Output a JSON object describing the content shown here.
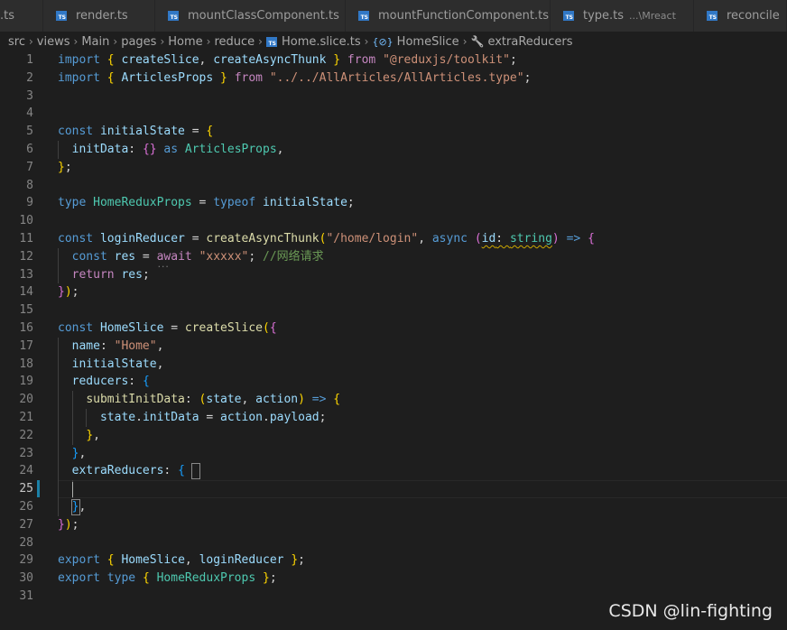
{
  "tabs": [
    {
      "label": ".ts",
      "desc": ""
    },
    {
      "label": "render.ts",
      "desc": ""
    },
    {
      "label": "mountClassComponent.ts",
      "desc": ""
    },
    {
      "label": "mountFunctionComponent.ts",
      "desc": ""
    },
    {
      "label": "type.ts",
      "desc": "...\\Mreact"
    },
    {
      "label": "reconcile",
      "desc": ""
    }
  ],
  "breadcrumb": [
    "src",
    "views",
    "Main",
    "pages",
    "Home",
    "reduce",
    "Home.slice.ts",
    "HomeSlice",
    "extraReducers"
  ],
  "editor": {
    "current_line": 25,
    "lines": [
      [
        [
          "k",
          "import"
        ],
        [
          "p",
          " "
        ],
        [
          "b1",
          "{"
        ],
        [
          "p",
          " "
        ],
        [
          "v",
          "createSlice"
        ],
        [
          "p",
          ", "
        ],
        [
          "v",
          "createAsyncThunk"
        ],
        [
          "p",
          " "
        ],
        [
          "b1",
          "}"
        ],
        [
          "p",
          " "
        ],
        [
          "c",
          "from"
        ],
        [
          "p",
          " "
        ],
        [
          "s",
          "\"@reduxjs/toolkit\""
        ],
        [
          "p",
          ";"
        ]
      ],
      [
        [
          "k",
          "import"
        ],
        [
          "p",
          " "
        ],
        [
          "b1",
          "{"
        ],
        [
          "p",
          " "
        ],
        [
          "v",
          "ArticlesProps"
        ],
        [
          "p",
          " "
        ],
        [
          "b1",
          "}"
        ],
        [
          "p",
          " "
        ],
        [
          "c",
          "from"
        ],
        [
          "p",
          " "
        ],
        [
          "s",
          "\"../../AllArticles/AllArticles.type\""
        ],
        [
          "p",
          ";"
        ]
      ],
      [],
      [],
      [
        [
          "k",
          "const"
        ],
        [
          "p",
          " "
        ],
        [
          "v",
          "initialState"
        ],
        [
          "p",
          " = "
        ],
        [
          "b1",
          "{"
        ]
      ],
      [
        [
          "p",
          "  "
        ],
        [
          "v",
          "initData"
        ],
        [
          "p",
          ": "
        ],
        [
          "b2",
          "{}"
        ],
        [
          "p",
          " "
        ],
        [
          "k",
          "as"
        ],
        [
          "p",
          " "
        ],
        [
          "t",
          "ArticlesProps"
        ],
        [
          "p",
          ","
        ]
      ],
      [
        [
          "b1",
          "}"
        ],
        [
          "p",
          ";"
        ]
      ],
      [],
      [
        [
          "k",
          "type"
        ],
        [
          "p",
          " "
        ],
        [
          "t",
          "HomeReduxProps"
        ],
        [
          "p",
          " = "
        ],
        [
          "k",
          "typeof"
        ],
        [
          "p",
          " "
        ],
        [
          "v",
          "initialState"
        ],
        [
          "p",
          ";"
        ]
      ],
      [],
      [
        [
          "k",
          "const"
        ],
        [
          "p",
          " "
        ],
        [
          "v",
          "loginReducer"
        ],
        [
          "p",
          " = "
        ],
        [
          "f",
          "createAsyncThunk"
        ],
        [
          "b1",
          "("
        ],
        [
          "s",
          "\"/home/login\""
        ],
        [
          "p",
          ", "
        ],
        [
          "k",
          "async"
        ],
        [
          "p",
          " "
        ],
        [
          "b2",
          "("
        ],
        [
          "v sq",
          "id"
        ],
        [
          "p sq",
          ": "
        ],
        [
          "t sq",
          "string"
        ],
        [
          "b2",
          ")"
        ],
        [
          "p",
          " "
        ],
        [
          "k",
          "=>"
        ],
        [
          "p",
          " "
        ],
        [
          "b2",
          "{"
        ]
      ],
      [
        [
          "p",
          "  "
        ],
        [
          "k",
          "const"
        ],
        [
          "p",
          " "
        ],
        [
          "v",
          "res"
        ],
        [
          "p",
          " = "
        ],
        [
          "c dots",
          "await"
        ],
        [
          "p",
          " "
        ],
        [
          "s",
          "\"xxxxx\""
        ],
        [
          "p",
          "; "
        ],
        [
          "cm",
          "//网络请求"
        ]
      ],
      [
        [
          "p",
          "  "
        ],
        [
          "c",
          "return"
        ],
        [
          "p",
          " "
        ],
        [
          "v",
          "res"
        ],
        [
          "p",
          ";"
        ]
      ],
      [
        [
          "b2",
          "}"
        ],
        [
          "b1",
          ")"
        ],
        [
          "p",
          ";"
        ]
      ],
      [],
      [
        [
          "k",
          "const"
        ],
        [
          "p",
          " "
        ],
        [
          "v",
          "HomeSlice"
        ],
        [
          "p",
          " = "
        ],
        [
          "f",
          "createSlice"
        ],
        [
          "b1",
          "("
        ],
        [
          "b2",
          "{"
        ]
      ],
      [
        [
          "p",
          "  "
        ],
        [
          "v",
          "name"
        ],
        [
          "p",
          ": "
        ],
        [
          "s",
          "\"Home\""
        ],
        [
          "p",
          ","
        ]
      ],
      [
        [
          "p",
          "  "
        ],
        [
          "v",
          "initialState"
        ],
        [
          "p",
          ","
        ]
      ],
      [
        [
          "p",
          "  "
        ],
        [
          "v",
          "reducers"
        ],
        [
          "p",
          ": "
        ],
        [
          "b3",
          "{"
        ]
      ],
      [
        [
          "p",
          "    "
        ],
        [
          "f",
          "submitInitData"
        ],
        [
          "p",
          ": "
        ],
        [
          "b1",
          "("
        ],
        [
          "v",
          "state"
        ],
        [
          "p",
          ", "
        ],
        [
          "v",
          "action"
        ],
        [
          "b1",
          ")"
        ],
        [
          "p",
          " "
        ],
        [
          "k",
          "=>"
        ],
        [
          "p",
          " "
        ],
        [
          "b1",
          "{"
        ]
      ],
      [
        [
          "p",
          "      "
        ],
        [
          "v",
          "state"
        ],
        [
          "p",
          "."
        ],
        [
          "v",
          "initData"
        ],
        [
          "p",
          " = "
        ],
        [
          "v",
          "action"
        ],
        [
          "p",
          "."
        ],
        [
          "v",
          "payload"
        ],
        [
          "p",
          ";"
        ]
      ],
      [
        [
          "p",
          "    "
        ],
        [
          "b1",
          "}"
        ],
        [
          "p",
          ","
        ]
      ],
      [
        [
          "p",
          "  "
        ],
        [
          "b3",
          "}"
        ],
        [
          "p",
          ","
        ]
      ],
      [
        [
          "p",
          "  "
        ],
        [
          "v",
          "extraReducers"
        ],
        [
          "p",
          ": "
        ],
        [
          "b3",
          "{"
        ]
      ],
      [],
      [
        [
          "p",
          "  "
        ],
        [
          "b3",
          "}"
        ],
        [
          "p",
          ","
        ]
      ],
      [
        [
          "b2",
          "}"
        ],
        [
          "b1",
          ")"
        ],
        [
          "p",
          ";"
        ]
      ],
      [],
      [
        [
          "k",
          "export"
        ],
        [
          "p",
          " "
        ],
        [
          "b1",
          "{"
        ],
        [
          "p",
          " "
        ],
        [
          "v",
          "HomeSlice"
        ],
        [
          "p",
          ", "
        ],
        [
          "v",
          "loginReducer"
        ],
        [
          "p",
          " "
        ],
        [
          "b1",
          "}"
        ],
        [
          "p",
          ";"
        ]
      ],
      [
        [
          "k",
          "export"
        ],
        [
          "p",
          " "
        ],
        [
          "k",
          "type"
        ],
        [
          "p",
          " "
        ],
        [
          "b1",
          "{"
        ],
        [
          "p",
          " "
        ],
        [
          "t",
          "HomeReduxProps"
        ],
        [
          "p",
          " "
        ],
        [
          "b1",
          "}"
        ],
        [
          "p",
          ";"
        ]
      ],
      []
    ]
  },
  "watermark": "CSDN @lin-fighting"
}
